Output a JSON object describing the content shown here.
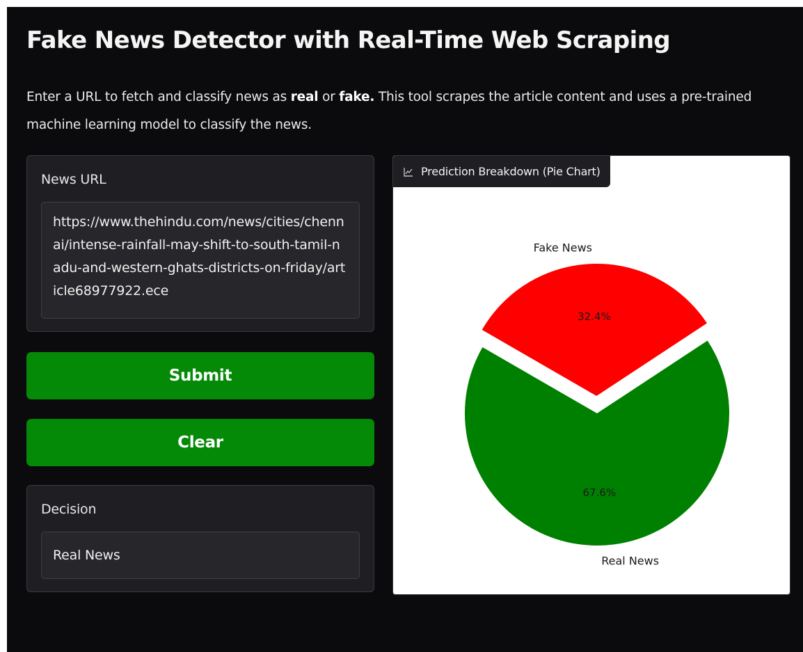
{
  "header": {
    "title": "Fake News Detector with Real-Time Web Scraping",
    "desc_before": "Enter a URL to fetch and classify news as ",
    "desc_real": "real",
    "desc_or": " or ",
    "desc_fake": "fake.",
    "desc_after": " This tool scrapes the article content and uses a pre-trained machine learning model to classify the news."
  },
  "url_input": {
    "label": "News URL",
    "value": "https://www.thehindu.com/news/cities/chennai/intense-rainfall-may-shift-to-south-tamil-nadu-and-western-ghats-districts-on-friday/article68977922.ece"
  },
  "buttons": {
    "submit": "Submit",
    "clear": "Clear",
    "color": "#048a06"
  },
  "decision": {
    "label": "Decision",
    "value": "Real News"
  },
  "chart_panel": {
    "tab_label": "Prediction Breakdown (Pie Chart)",
    "tab_icon": "chart-icon"
  },
  "chart_data": {
    "type": "pie",
    "categories": [
      "Real News",
      "Fake News"
    ],
    "values": [
      67.6,
      32.4
    ],
    "labels": [
      "67.6%",
      "32.4%"
    ],
    "colors": [
      "#008000",
      "#ff0000"
    ],
    "exploded": [
      "Fake News"
    ]
  }
}
